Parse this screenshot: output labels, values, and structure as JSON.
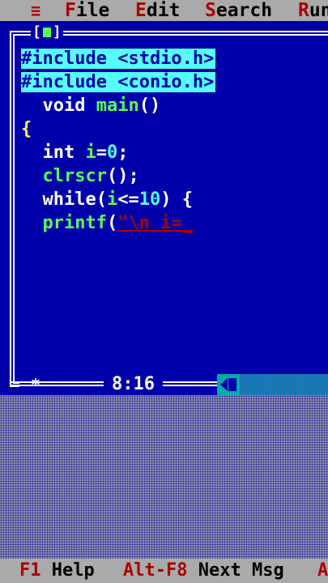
{
  "menu": {
    "system_label": "≡",
    "items": [
      {
        "hot": "F",
        "rest": "ile"
      },
      {
        "hot": "E",
        "rest": "dit"
      },
      {
        "hot": "S",
        "rest": "earch"
      },
      {
        "hot": "R",
        "rest": "un"
      }
    ]
  },
  "editor": {
    "close_box": "[■]",
    "close_left": "[",
    "close_right": "]",
    "lines": [
      {
        "text": "#include <stdio.h>"
      },
      {
        "text": "#include <conio.h>"
      },
      {
        "indent": "  ",
        "kw": "void",
        "id": "main",
        "rest": "()"
      },
      {
        "text": "{"
      },
      {
        "indent": "  ",
        "kw": "int",
        "id": "i",
        "op": "=",
        "num": "0",
        "end": ";"
      },
      {
        "indent": "  ",
        "id": "clrscr",
        "rest": "();"
      },
      {
        "indent": "  ",
        "kw": "while",
        "rest1": "(",
        "id": "i",
        "op": "<=",
        "num": "10",
        "rest2": ") {"
      },
      {
        "indent": "  ",
        "id": "printf",
        "rest1": "(",
        "str": "\"\\n i=",
        "cursor": "_"
      }
    ]
  },
  "status": {
    "modified_marker": "*",
    "cursor_position": "8:16"
  },
  "hints": [
    {
      "key": "F1",
      "label": "Help"
    },
    {
      "key": "Alt-F8",
      "label": "Next Msg"
    },
    {
      "key": "A",
      "label": ""
    }
  ],
  "colors": {
    "editor_bg": "#0000aa",
    "menu_bg": "#aaaaaa",
    "hotkey": "#aa0000",
    "highlight": "#55ffff",
    "identifier": "#55ff55",
    "keyword": "#ffffff"
  }
}
